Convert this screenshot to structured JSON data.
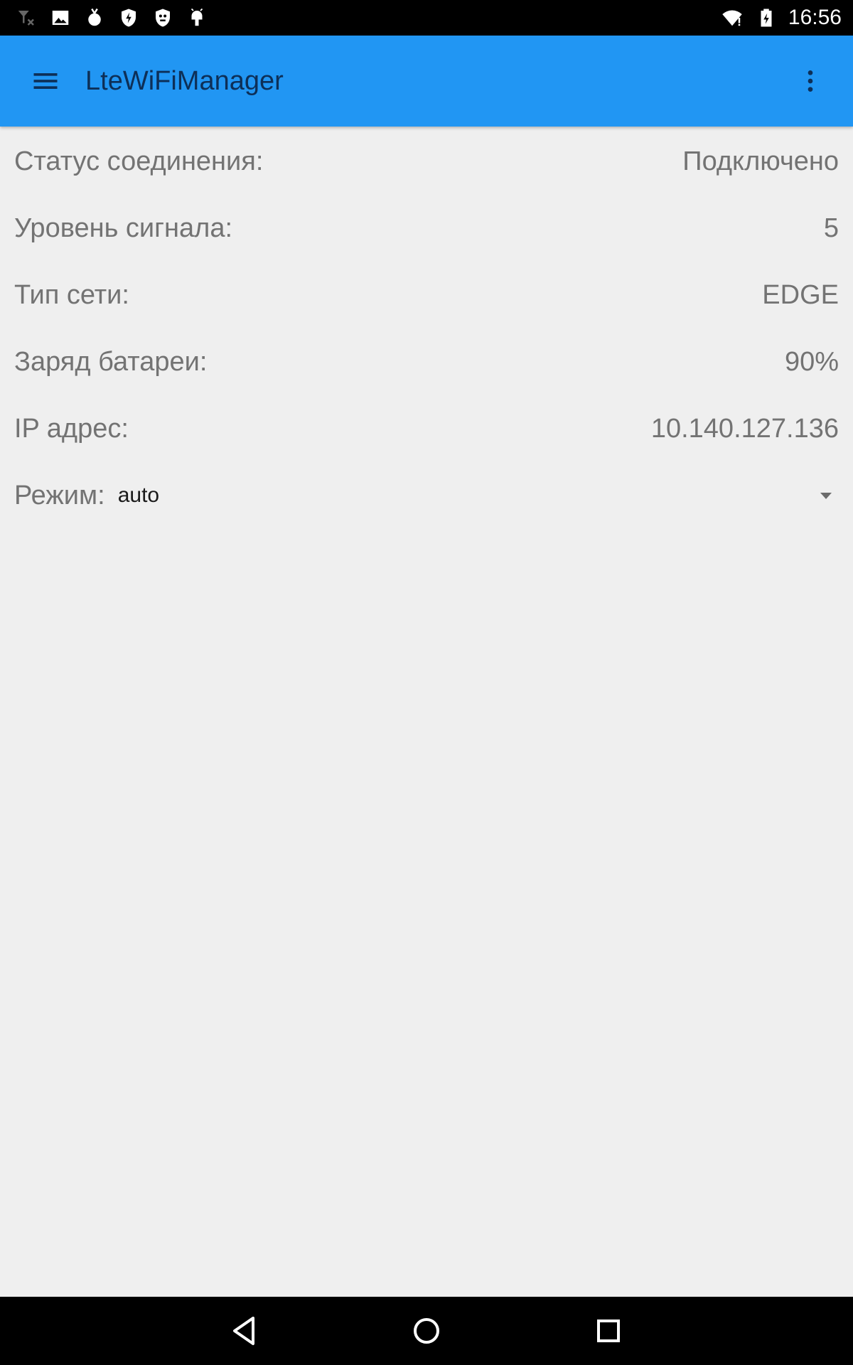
{
  "status_bar": {
    "time": "16:56",
    "left_icons": [
      "no-signal-icon",
      "image-icon",
      "bomb-icon",
      "shield-bolt-icon",
      "skull-shield-icon",
      "android-icon"
    ],
    "right_icons": [
      "wifi-icon",
      "battery-charging-icon"
    ]
  },
  "app_bar": {
    "title": "LteWiFiManager",
    "background_color": "#2196f3"
  },
  "info": {
    "connection_status": {
      "label": "Статус соединения:",
      "value": "Подключено"
    },
    "signal_level": {
      "label": "Уровень сигнала:",
      "value": "5"
    },
    "network_type": {
      "label": "Тип сети:",
      "value": "EDGE"
    },
    "battery": {
      "label": "Заряд батареи:",
      "value": "90%"
    },
    "ip_address": {
      "label": "IP адрес:",
      "value": "10.140.127.136"
    }
  },
  "mode": {
    "label": "Режим:",
    "selected": "auto"
  },
  "nav_bar": {
    "icons": [
      "back-icon",
      "home-icon",
      "recents-icon"
    ]
  }
}
